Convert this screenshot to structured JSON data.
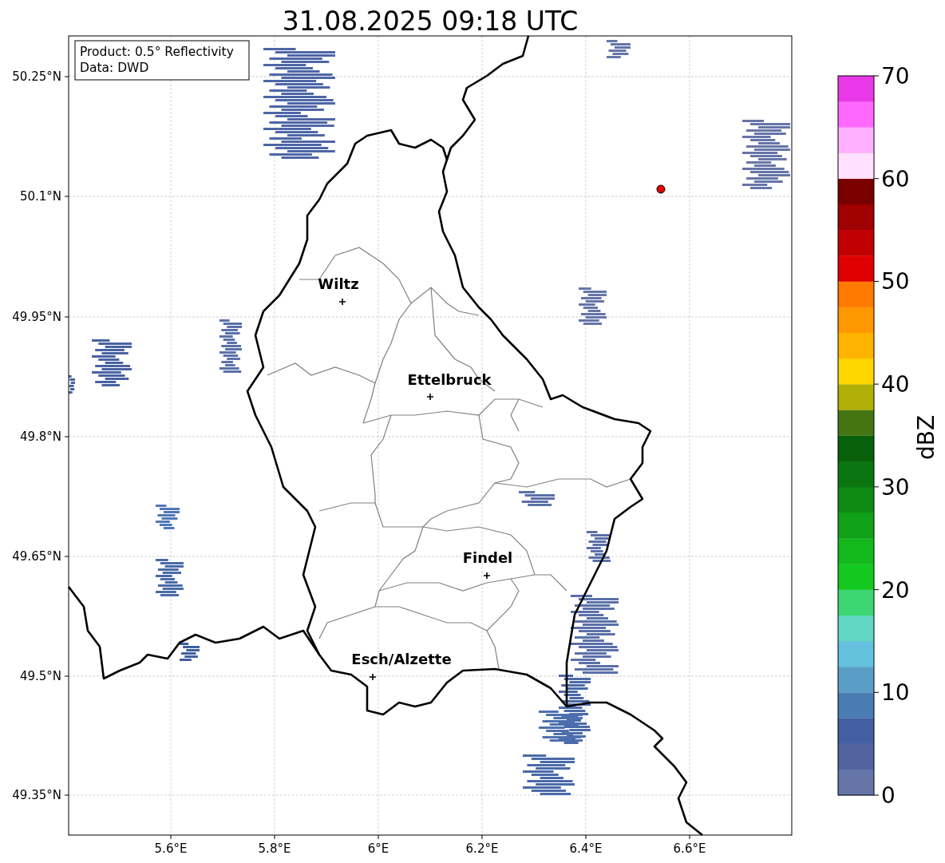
{
  "title": "31.08.2025 09:18 UTC",
  "info_box": {
    "lines": [
      "Product: 0.5° Reflectivity",
      "Data: DWD"
    ]
  },
  "y_ticks": [
    "50.25°N",
    "50.1°N",
    "49.95°N",
    "49.8°N",
    "49.65°N",
    "49.5°N",
    "49.35°N"
  ],
  "x_ticks": [
    "5.6°E",
    "5.8°E",
    "6°E",
    "6.2°E",
    "6.4°E",
    "6.6°E"
  ],
  "cities": [
    {
      "name": "Wiltz"
    },
    {
      "name": "Ettelbruck"
    },
    {
      "name": "Findel"
    },
    {
      "name": "Esch/Alzette"
    }
  ],
  "colorbar": {
    "label": "dBZ",
    "ticks": [
      "70",
      "60",
      "50",
      "40",
      "30",
      "20",
      "10",
      "0"
    ],
    "segments": [
      {
        "color": "#6675a8"
      },
      {
        "color": "#5263a0"
      },
      {
        "color": "#4260a3"
      },
      {
        "color": "#4a7bb3"
      },
      {
        "color": "#5a9ec8"
      },
      {
        "color": "#64c0dc"
      },
      {
        "color": "#62d8c4"
      },
      {
        "color": "#3dd672"
      },
      {
        "color": "#13c81f"
      },
      {
        "color": "#12b81c"
      },
      {
        "color": "#11a118"
      },
      {
        "color": "#0e8a13"
      },
      {
        "color": "#0b7510"
      },
      {
        "color": "#08600d"
      },
      {
        "color": "#457510"
      },
      {
        "color": "#b0b008"
      },
      {
        "color": "#ffd700"
      },
      {
        "color": "#ffb400"
      },
      {
        "color": "#ff9800"
      },
      {
        "color": "#ff7a00"
      },
      {
        "color": "#e00000"
      },
      {
        "color": "#c00000"
      },
      {
        "color": "#a00000"
      },
      {
        "color": "#7a0000"
      },
      {
        "color": "#ffe0ff"
      },
      {
        "color": "#ffb0ff"
      },
      {
        "color": "#ff68ff"
      },
      {
        "color": "#e838e8"
      }
    ]
  }
}
